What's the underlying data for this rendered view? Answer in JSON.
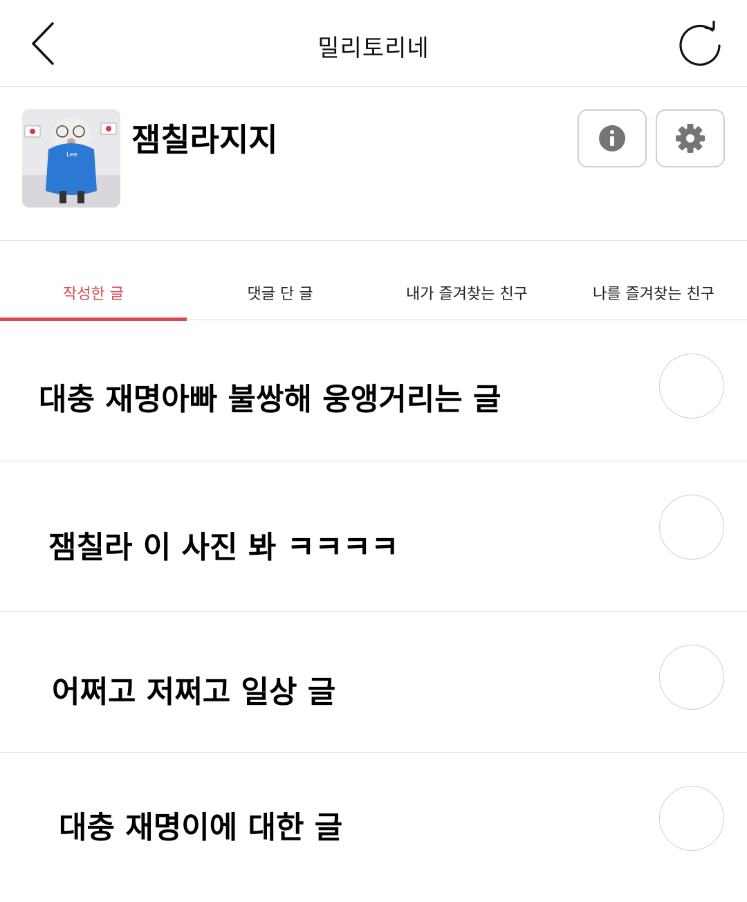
{
  "header": {
    "title": "밀리토리네",
    "back_icon": "chevron-left-icon",
    "refresh_icon": "refresh-icon"
  },
  "profile": {
    "name": "잼칠라지지",
    "info_icon": "info-icon",
    "settings_icon": "gear-icon"
  },
  "tabs": [
    {
      "label": "작성한 글",
      "active": true
    },
    {
      "label": "댓글 단 글",
      "active": false
    },
    {
      "label": "내가 즐겨찾는 친구",
      "active": false
    },
    {
      "label": "나를 즐겨찾는 친구",
      "active": false
    }
  ],
  "posts": [
    {
      "title": "대충 재명아빠 불쌍해 웅앵거리는 글"
    },
    {
      "title": "잼칠라 이 사진 봐 ㅋㅋㅋㅋ"
    },
    {
      "title": "어쩌고 저쩌고 일상 글"
    },
    {
      "title": "대충 재명이에 대한 글"
    }
  ],
  "colors": {
    "accent": "#d9484d",
    "divider": "#d9d9d9",
    "text": "#111111"
  }
}
